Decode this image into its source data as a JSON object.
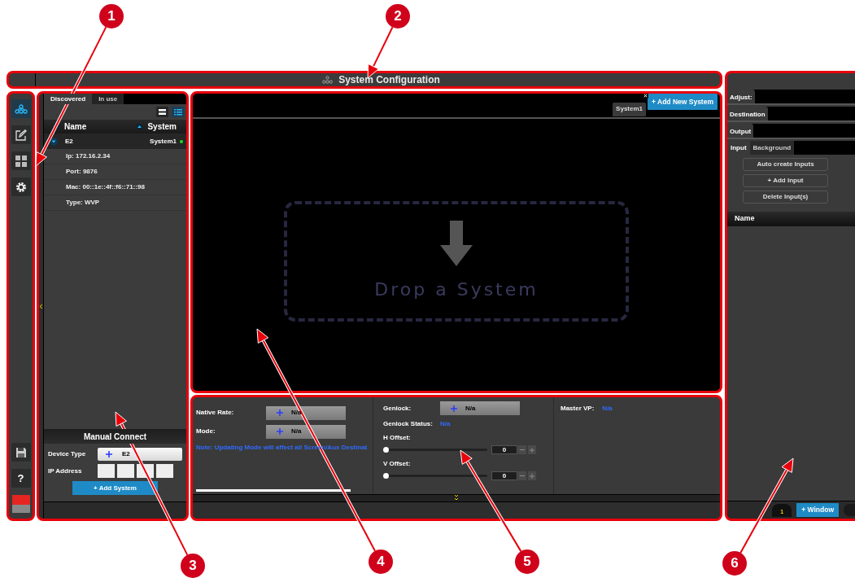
{
  "callouts": [
    {
      "number": "1"
    },
    {
      "number": "2"
    },
    {
      "number": "3"
    },
    {
      "number": "4"
    },
    {
      "number": "5"
    },
    {
      "number": "6"
    }
  ],
  "title_bar": {
    "title": "System Configuration"
  },
  "nav_rail": {
    "items": [
      {
        "kind": "network",
        "selected": true
      },
      {
        "kind": "edit",
        "selected": false
      },
      {
        "kind": "grid",
        "selected": false
      },
      {
        "kind": "settings",
        "selected": false
      }
    ],
    "help_label": "?"
  },
  "system_list": {
    "tabs": [
      {
        "label": "Discovered",
        "selected": true
      },
      {
        "label": "In use",
        "selected": false
      }
    ],
    "view_modes": [
      {
        "kind": "compact",
        "selected": false
      },
      {
        "kind": "detailed",
        "selected": true
      }
    ],
    "columns": [
      "Name",
      "System"
    ],
    "devices": [
      {
        "name": "E2",
        "system": "System1",
        "expanded": true,
        "online": true,
        "details": [
          "Ip: 172.16.2.34",
          "Port: 9876",
          "Mac: 00::1e::4f::f6::71::98",
          "Type: WVP"
        ]
      }
    ]
  },
  "manual_connect": {
    "title": "Manual Connect",
    "device_type_label": "Device Type",
    "device_type": "E2",
    "ip_label": "IP Address",
    "add_button": "+ Add System"
  },
  "canvas": {
    "tabs": [
      {
        "label": "System1",
        "selected": true
      }
    ],
    "add_button": "+ Add New System",
    "drop_text": "Drop a System"
  },
  "properties": {
    "native_rate": {
      "label": "Native Rate:",
      "value": "N/a"
    },
    "mode": {
      "label": "Mode:",
      "value": "N/a"
    },
    "note": "Note: Updating Mode will affect all Screen/Aux Destinat",
    "genlock": {
      "label": "Genlock:",
      "value": "N/a"
    },
    "genlock_status": {
      "label": "Genlock Status:",
      "value": "N/a"
    },
    "offsets": [
      {
        "label": "H Offset:",
        "level": 0,
        "value": "0"
      },
      {
        "label": "V Offset:",
        "level": 0,
        "value": "0"
      }
    ],
    "master_vp": {
      "label": "Master VP:",
      "value": "N/a"
    }
  },
  "right_panel": {
    "sections": [
      "Adjust:",
      "Destination",
      "Output"
    ],
    "tabs": [
      {
        "label": "Input",
        "selected": true
      },
      {
        "label": "Background",
        "selected": false
      }
    ],
    "buttons": [
      "Auto create Inputs",
      "+ Add Input",
      "Delete Input(s)"
    ],
    "columns": [
      "Name"
    ],
    "layer_count": "1",
    "add_window_button": "+ Window"
  }
}
